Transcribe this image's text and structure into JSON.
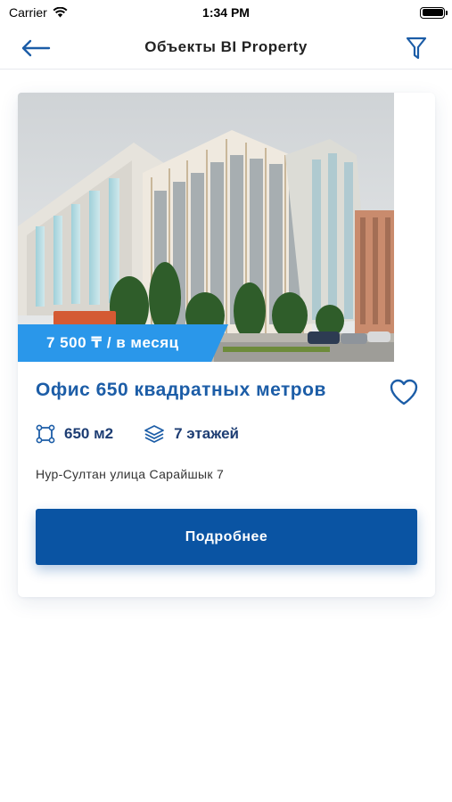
{
  "status_bar": {
    "carrier": "Carrier",
    "time": "1:34 PM"
  },
  "navbar": {
    "title": "Объекты BI Property"
  },
  "listing": {
    "price": "7 500 ₸ / в месяц",
    "title": "Офис 650 квадратных метров",
    "area": "650 м2",
    "floors": "7 этажей",
    "address": "Нур-Султан улица Сарайшык 7",
    "details_button": "Подробнее"
  },
  "colors": {
    "accent": "#1c5da7",
    "price_tag": "#2a97ea",
    "button": "#0a54a3",
    "spec_text": "#1d3d73"
  }
}
